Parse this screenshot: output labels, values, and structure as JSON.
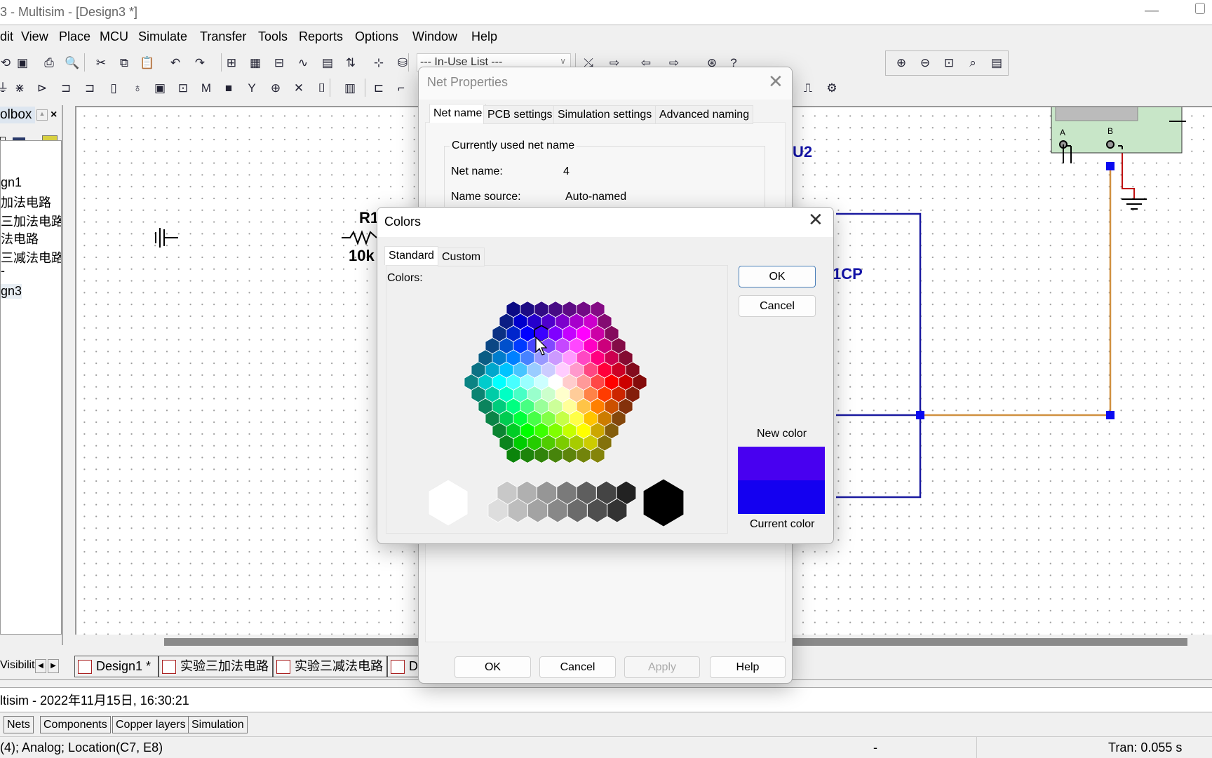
{
  "window": {
    "title": "3 - Multisim - [Design3 *]"
  },
  "menu": [
    "dit",
    "View",
    "Place",
    "MCU",
    "Simulate",
    "Transfer",
    "Tools",
    "Reports",
    "Options",
    "Window",
    "Help"
  ],
  "toolbar": {
    "in_use_list": "--- In-Use List ---",
    "row1": [
      {
        "name": "open-icon",
        "glyph": "⟲"
      },
      {
        "name": "save-icon",
        "glyph": "▣"
      },
      {
        "name": "print-icon",
        "glyph": "⎙"
      },
      {
        "name": "print-preview-icon",
        "glyph": "🔍"
      },
      {
        "name": "cut-icon",
        "glyph": "✂"
      },
      {
        "name": "copy-icon",
        "glyph": "⧉"
      },
      {
        "name": "paste-icon",
        "glyph": "📋"
      },
      {
        "name": "undo-icon",
        "glyph": "↶"
      },
      {
        "name": "redo-icon",
        "glyph": "↷"
      },
      {
        "name": "hierarchy-icon",
        "glyph": "⊞"
      },
      {
        "name": "spreadsheet-icon",
        "glyph": "▦"
      },
      {
        "name": "sim-database-icon",
        "glyph": "⊟"
      },
      {
        "name": "grapher-icon",
        "glyph": "∿"
      },
      {
        "name": "postprocessor-icon",
        "glyph": "▤"
      },
      {
        "name": "electrical-rules-icon",
        "glyph": "⇅"
      },
      {
        "name": "component-wizard-icon",
        "glyph": "⊹"
      },
      {
        "name": "database-manager-icon",
        "glyph": "⛁"
      }
    ],
    "row1b": [
      {
        "name": "transfer-ultiboard-icon",
        "glyph": "⤯"
      },
      {
        "name": "forward-annotate-icon",
        "glyph": "⇨"
      },
      {
        "name": "back-annotate-icon",
        "glyph": "⇦"
      },
      {
        "name": "export-icon",
        "glyph": "⇨"
      },
      {
        "name": "find-examples-icon",
        "glyph": "⊛"
      },
      {
        "name": "help-icon",
        "glyph": "?"
      }
    ],
    "row2": [
      {
        "name": "source-icon",
        "glyph": "⏚"
      },
      {
        "name": "basic-icon",
        "glyph": "⋇"
      },
      {
        "name": "diode-icon",
        "glyph": "⊳"
      },
      {
        "name": "ttl-icon",
        "glyph": "⊐"
      },
      {
        "name": "cmos-icon",
        "glyph": "⊐"
      },
      {
        "name": "mixed-icon",
        "glyph": "▯"
      },
      {
        "name": "indicator-icon",
        "glyph": "♁"
      },
      {
        "name": "power-icon",
        "glyph": "▣"
      },
      {
        "name": "misc-digital-icon",
        "glyph": "⊡"
      },
      {
        "name": "misc-icon",
        "glyph": "M"
      },
      {
        "name": "advanced-peripherals-icon",
        "glyph": "■"
      },
      {
        "name": "rf-icon",
        "glyph": "Y"
      },
      {
        "name": "electromechanical-icon",
        "glyph": "⊕"
      },
      {
        "name": "ni-icon",
        "glyph": "✕"
      },
      {
        "name": "connector-icon",
        "glyph": "⌷"
      },
      {
        "name": "mcu-icon",
        "glyph": "▥"
      },
      {
        "name": "hierarchical-block-icon",
        "glyph": "⊏"
      },
      {
        "name": "bus-icon",
        "glyph": "⌐"
      }
    ],
    "row2b": [
      {
        "name": "probe-icon",
        "glyph": "⎍"
      },
      {
        "name": "settings-gear-icon",
        "glyph": "⚙"
      }
    ],
    "zoom": [
      {
        "name": "zoom-in-icon",
        "glyph": "⊕"
      },
      {
        "name": "zoom-out-icon",
        "glyph": "⊖"
      },
      {
        "name": "zoom-area-icon",
        "glyph": "⊡"
      },
      {
        "name": "zoom-sheet-icon",
        "glyph": "⌕"
      },
      {
        "name": "full-screen-icon",
        "glyph": "▤"
      }
    ]
  },
  "toolbox": {
    "title": "olbox",
    "tree": [
      "gn1",
      "加法电路",
      "三加法电路",
      "法电路",
      "三减法电路",
      "-",
      "gn3"
    ]
  },
  "canvas": {
    "r1": "R1",
    "r1_value": "10k",
    "u2": "U2",
    "part": "1CP",
    "term_a": "A",
    "term_b": "B",
    "colors": {
      "wire_blue": "#1a1aa0",
      "wire_orange": "#d09040",
      "wire_red": "#c01010",
      "junction": "#0a0af0",
      "label_blue": "#1414a8",
      "instrument": "#c8e6c8"
    }
  },
  "design_tabs": {
    "visibility": "Visibilit",
    "tabs": [
      "Design1 *",
      "实验三加法电路",
      "实验三减法电路",
      "D"
    ]
  },
  "log": "ltisim  -  2022年11月15日, 16:30:21",
  "bottom_tabs": [
    "Nets",
    "Components",
    "Copper layers",
    "Simulation"
  ],
  "status": {
    "left": "(4); Analog; Location(C7, E8)",
    "mid": "-",
    "right": "Tran: 0.055 s"
  },
  "net_properties": {
    "title": "Net Properties",
    "tabs": [
      "Net name",
      "PCB settings",
      "Simulation settings",
      "Advanced naming"
    ],
    "group_title": "Currently used net name",
    "net_name_label": "Net name:",
    "net_name_value": "4",
    "source_label": "Name source:",
    "source_value": "Auto-named",
    "buttons": {
      "ok": "OK",
      "cancel": "Cancel",
      "apply": "Apply",
      "help": "Help"
    }
  },
  "colors_dialog": {
    "title": "Colors",
    "tabs": [
      "Standard",
      "Custom"
    ],
    "colors_label": "Colors:",
    "ok": "OK",
    "cancel": "Cancel",
    "new_color_label": "New color",
    "current_color_label": "Current color",
    "new_color": "#4800f0",
    "current_color": "#1400f0",
    "grays_top": [
      "#c8c8c8",
      "#b0b0b0",
      "#969696",
      "#7a7a7a",
      "#5e5e5e",
      "#444444",
      "#222222"
    ],
    "grays_bottom": [
      "#dddddd",
      "#bdbdbd",
      "#a3a3a3",
      "#888888",
      "#6b6b6b",
      "#4f4f4f",
      "#333333"
    ],
    "white": "#ffffff",
    "black": "#000000"
  }
}
